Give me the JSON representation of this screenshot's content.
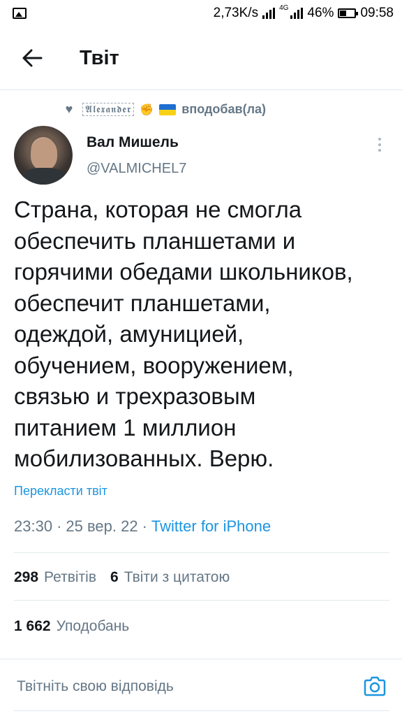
{
  "status_bar": {
    "net_speed": "2,73K/s",
    "network_type": "4G",
    "battery": "46%",
    "battery_level": 0.46,
    "time": "09:58"
  },
  "header": {
    "back_icon": "arrow-left-icon",
    "title": "Твіт"
  },
  "social_context": {
    "liker_name": "𝕬𝖑𝖊𝖝𝖆𝖓𝖉𝖊𝖗",
    "action": "вподобав(ла)"
  },
  "tweet": {
    "author_name": "Вал Мишель",
    "author_handle": "@VALMICHEL7",
    "text": "Страна, которая не смогла\nобеспечить планшетами и\nгорячими обедами школьников,\nобеспечит планшетами,\nодеждой, амуницией,\nобучением, вооружением,\nсвязью и трехразовым\nпитанием 1 миллион\nмобилизованных. Верю.",
    "translate_label": "Перекласти твіт",
    "time": "23:30",
    "date": "25 вер. 22",
    "source": "Twitter for iPhone",
    "separator": "·"
  },
  "stats": {
    "retweets_count": "298",
    "retweets_label": "Ретвітів",
    "quotes_count": "6",
    "quotes_label": "Твіти з цитатою",
    "likes_count": "1 662",
    "likes_label": "Уподобань"
  },
  "reply": {
    "placeholder": "Твітніть свою відповідь",
    "camera_icon": "camera-icon"
  },
  "colors": {
    "accent": "#1b95e0",
    "secondary_text": "#657786",
    "divider": "#e1e8ed"
  }
}
